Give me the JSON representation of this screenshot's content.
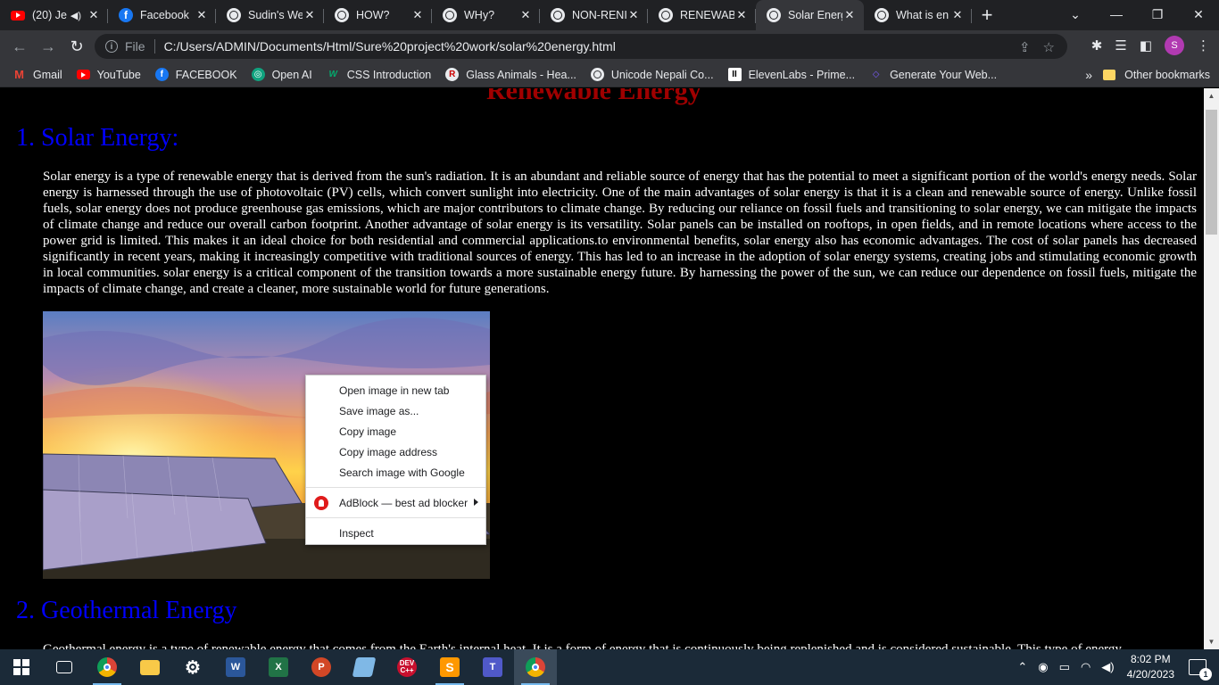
{
  "browser": {
    "tabs": [
      {
        "title": "(20) Je",
        "icon": "youtube-icon"
      },
      {
        "title": "Facebook",
        "icon": "facebook-icon"
      },
      {
        "title": "Sudin's We",
        "icon": "globe-icon"
      },
      {
        "title": "HOW?",
        "icon": "globe-icon"
      },
      {
        "title": "WHy?",
        "icon": "globe-icon"
      },
      {
        "title": "NON-RENI",
        "icon": "globe-icon"
      },
      {
        "title": "RENEWABI",
        "icon": "globe-icon"
      },
      {
        "title": "Solar Energ",
        "icon": "globe-icon",
        "active": true
      },
      {
        "title": "What is en",
        "icon": "globe-icon"
      }
    ],
    "address": {
      "scheme_label": "File",
      "url": "C:/Users/ADMIN/Documents/Html/Sure%20project%20work/solar%20energy.html"
    },
    "profile_initial": "S",
    "bookmarks": [
      {
        "label": "Gmail",
        "icon": "gmail-icon"
      },
      {
        "label": "YouTube",
        "icon": "youtube-icon"
      },
      {
        "label": "FACEBOOK",
        "icon": "facebook-icon"
      },
      {
        "label": "Open AI",
        "icon": "openai-icon"
      },
      {
        "label": "CSS Introduction",
        "icon": "w3schools-icon"
      },
      {
        "label": "Glass Animals - Hea...",
        "icon": "r-icon"
      },
      {
        "label": "Unicode Nepali Co...",
        "icon": "globe-icon"
      },
      {
        "label": "ElevenLabs - Prime...",
        "icon": "elevenlabs-icon"
      },
      {
        "label": "Generate Your Web...",
        "icon": "generate-icon"
      }
    ],
    "bookmarks_more": "»",
    "other_bookmarks": "Other bookmarks"
  },
  "page": {
    "heading": "Renewable Energy",
    "sections": [
      {
        "title": "1. Solar Energy:",
        "body": "Solar energy is a type of renewable energy that is derived from the sun's radiation. It is an abundant and reliable source of energy that has the potential to meet a significant portion of the world's energy needs. Solar energy is harnessed through the use of photovoltaic (PV) cells, which convert sunlight into electricity. One of the main advantages of solar energy is that it is a clean and renewable source of energy. Unlike fossil fuels, solar energy does not produce greenhouse gas emissions, which are major contributors to climate change. By reducing our reliance on fossil fuels and transitioning to solar energy, we can mitigate the impacts of climate change and reduce our overall carbon footprint. Another advantage of solar energy is its versatility. Solar panels can be installed on rooftops, in open fields, and in remote locations where access to the power grid is limited. This makes it an ideal choice for both residential and commercial applications.to environmental benefits, solar energy also has economic advantages. The cost of solar panels has decreased significantly in recent years, making it increasingly competitive with traditional sources of energy. This has led to an increase in the adoption of solar energy systems, creating jobs and stimulating economic growth in local communities. solar energy is a critical component of the transition towards a more sustainable energy future. By harnessing the power of the sun, we can reduce our dependence on fossil fuels, mitigate the impacts of climate change, and create a cleaner, more sustainable world for future generations."
      },
      {
        "title": "2. Geothermal Energy",
        "body": "Geothermal energy is a type of renewable energy that comes from the Earth's internal heat. It is a form of energy that is continuously being replenished and is considered sustainable. This type of energy"
      }
    ]
  },
  "context_menu": {
    "items": [
      "Open image in new tab",
      "Save image as...",
      "Copy image",
      "Copy image address",
      "Search image with Google"
    ],
    "extension": "AdBlock — best ad blocker",
    "inspect": "Inspect"
  },
  "taskbar": {
    "apps": [
      "task-view",
      "chrome",
      "file-explorer",
      "settings",
      "word",
      "excel",
      "powerpoint",
      "notepad",
      "dev-cpp",
      "sublime-text",
      "teams",
      "chrome-profile"
    ],
    "time": "8:02 PM",
    "date": "4/20/2023",
    "notification_count": "1"
  },
  "colors": {
    "heading": "#a00000",
    "section_title": "#0000ff",
    "page_bg": "#000000",
    "tab_bar": "#202124",
    "toolbar": "#35363a"
  }
}
